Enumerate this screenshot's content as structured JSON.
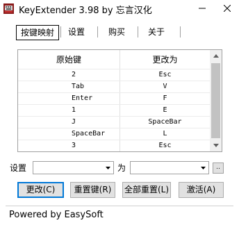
{
  "window": {
    "title": "KeyExtender 3.98 by 忘言汉化"
  },
  "tabs": [
    {
      "label": "按键映射",
      "active": true
    },
    {
      "label": "设置",
      "active": false
    },
    {
      "label": "购买",
      "active": false
    },
    {
      "label": "关于",
      "active": false
    }
  ],
  "table": {
    "headers": [
      "原始键",
      "更改为"
    ],
    "rows": [
      [
        "2",
        "Esc"
      ],
      [
        "Tab",
        "V"
      ],
      [
        "Enter",
        "F"
      ],
      [
        "1",
        "E"
      ],
      [
        "J",
        "SpaceBar"
      ],
      [
        "SpaceBar",
        "L"
      ],
      [
        "3",
        "Esc"
      ]
    ]
  },
  "form": {
    "set_label": "设置",
    "to_label": "为",
    "from_value": "",
    "to_value": "",
    "ellipsis_label": ".."
  },
  "buttons": {
    "change": "更改(C)",
    "reset_key": "重置键(R)",
    "reset_all": "全部重置(L)",
    "activate": "激活(A)"
  },
  "status": {
    "text": "Powered by EasySoft"
  },
  "colors": {
    "accent": "#0078d7",
    "app_icon": "#8a1a1a"
  }
}
